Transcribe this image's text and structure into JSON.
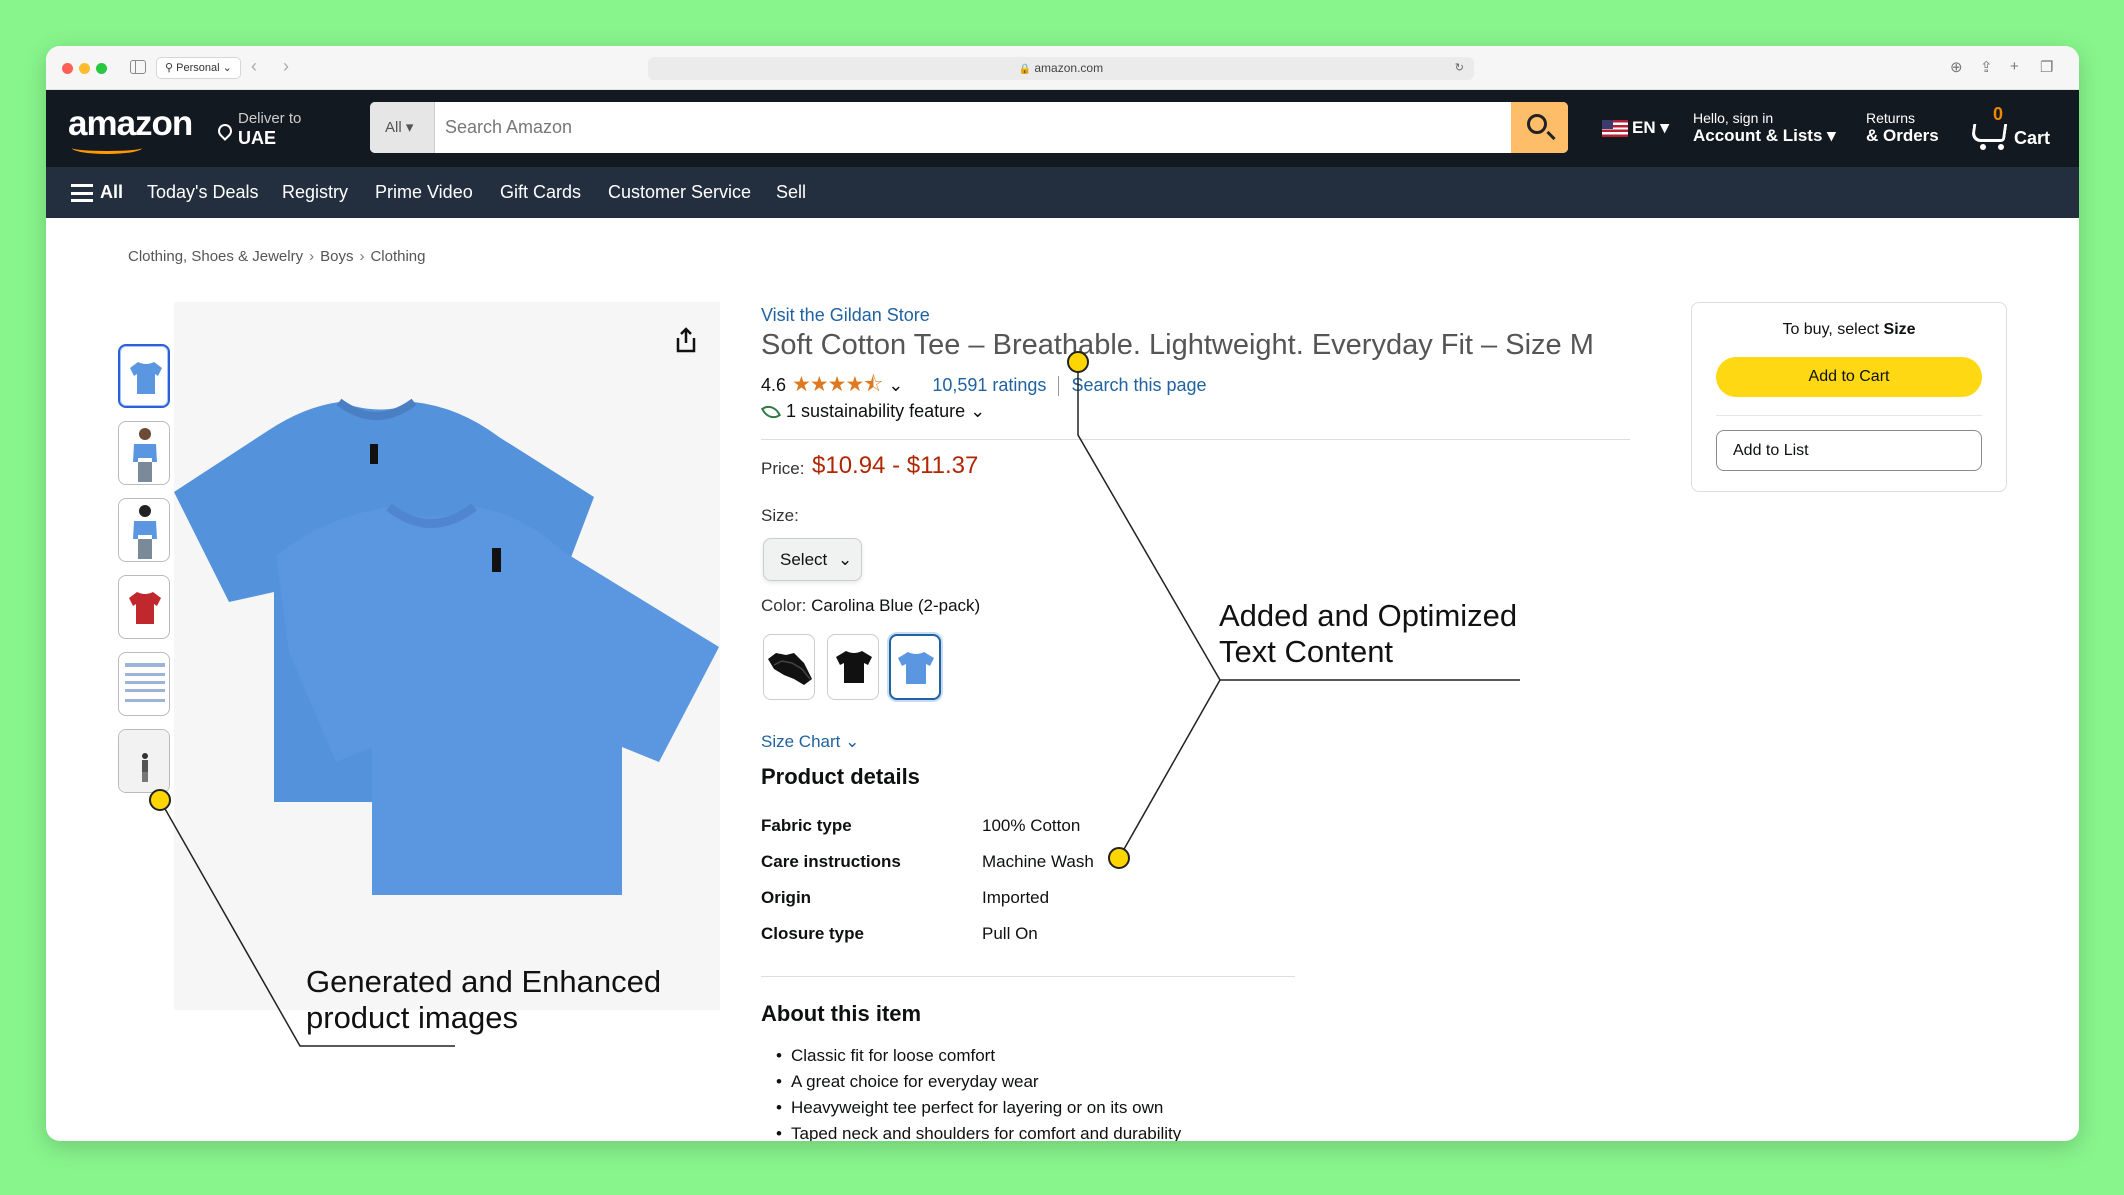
{
  "browser": {
    "profile": "Personal",
    "url": "amazon.com"
  },
  "header": {
    "logo": "amazon",
    "deliver_line1": "Deliver to",
    "deliver_line2": "UAE",
    "search_category": "All",
    "search_placeholder": "Search Amazon",
    "lang": "EN",
    "account_line1": "Hello, sign in",
    "account_line2": "Account & Lists",
    "returns_line1": "Returns",
    "returns_line2": "& Orders",
    "cart_count": "0",
    "cart_label": "Cart"
  },
  "subnav": {
    "all": "All",
    "items": [
      "Today's Deals",
      "Registry",
      "Prime Video",
      "Gift Cards",
      "Customer Service",
      "Sell"
    ]
  },
  "breadcrumb": [
    "Clothing, Shoes & Jewelry",
    "Boys",
    "Clothing"
  ],
  "product": {
    "store_link": "Visit the Gildan Store",
    "title": "Soft Cotton Tee – Breathable. Lightweight. Everyday Fit – Size M",
    "rating": "4.6",
    "stars": "★★★★⯪",
    "ratings_count": "10,591 ratings",
    "search_page": "Search this page",
    "sustainability": "1 sustainability feature",
    "price_label": "Price:",
    "price": "$10.94 - $11.37",
    "size_label": "Size:",
    "size_value": "Select",
    "color_label": "Color:",
    "color_value": "Carolina Blue (2-pack)",
    "size_chart": "Size Chart",
    "details_heading": "Product details",
    "details": [
      {
        "k": "Fabric type",
        "v": "100% Cotton"
      },
      {
        "k": "Care instructions",
        "v": "Machine Wash"
      },
      {
        "k": "Origin",
        "v": "Imported"
      },
      {
        "k": "Closure type",
        "v": "Pull On"
      }
    ],
    "about_heading": "About this item",
    "about": [
      "Classic fit for loose comfort",
      "A great choice for everyday wear",
      "Heavyweight tee perfect for layering or on its own",
      "Taped neck and shoulders for comfort and durability"
    ]
  },
  "buybox": {
    "hint_prefix": "To buy, select ",
    "hint_bold": "Size",
    "add_to_cart": "Add to Cart",
    "add_to_list": "Add to List"
  },
  "annotations": {
    "text": [
      "Added and Optimized",
      "Text Content"
    ],
    "images": [
      "Generated and Enhanced",
      "product images"
    ]
  },
  "colors": {
    "tee_blue": "#5b96e0",
    "swatch_red": "#c0282d",
    "price_red": "#b12704",
    "link_blue": "#2162a1",
    "cart_yellow": "#ffd814",
    "marker_yellow": "#ffd500"
  }
}
